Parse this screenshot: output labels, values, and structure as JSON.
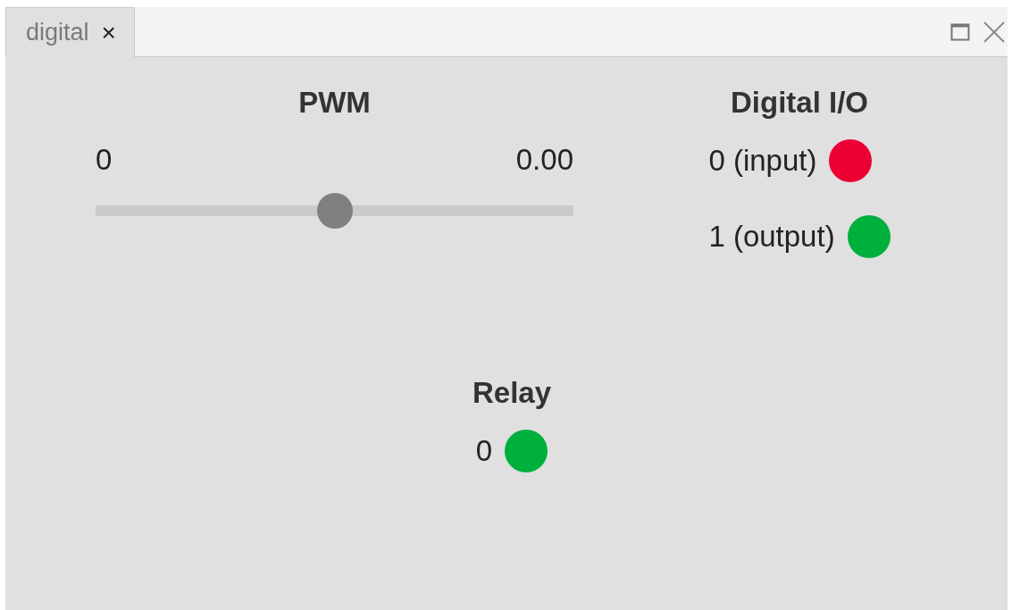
{
  "tabs": [
    {
      "label": "digital",
      "selected": true,
      "close": "×"
    }
  ],
  "pwm": {
    "title": "PWM",
    "min_label": "0",
    "reading": "0.00",
    "level": 0.5
  },
  "digital_io": {
    "title": "Digital I/O",
    "items": [
      {
        "label": "0 (input)",
        "color": "#ec0034"
      },
      {
        "label": "1 (output)",
        "color": "#00b03c"
      }
    ]
  },
  "relay": {
    "title": "Relay",
    "items": [
      {
        "label": "0",
        "color": "#00b03c"
      }
    ]
  }
}
